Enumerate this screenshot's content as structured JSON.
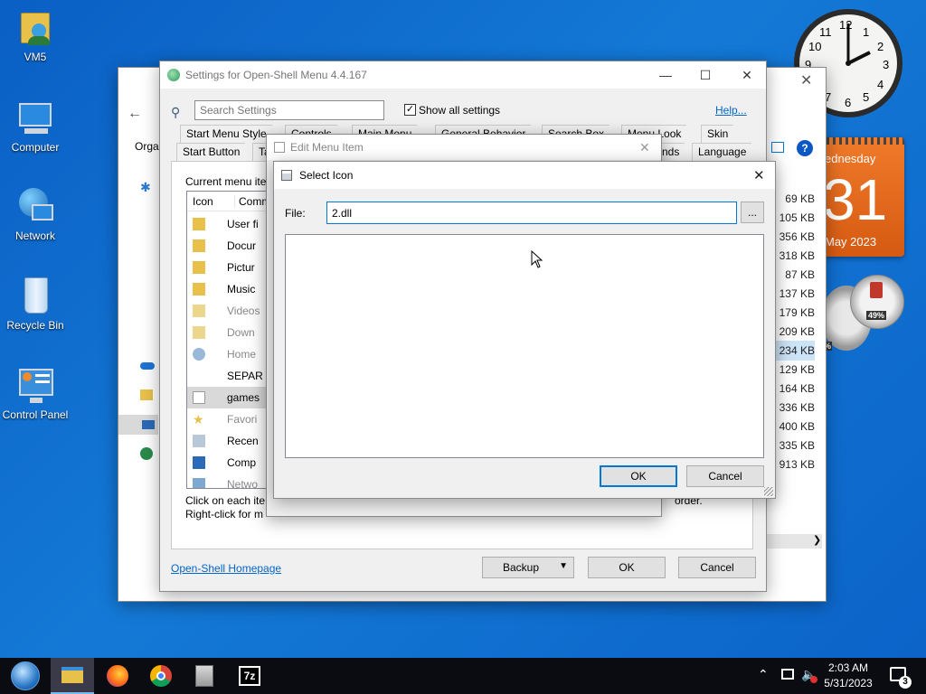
{
  "desktop": {
    "icons": [
      {
        "label": "VM5"
      },
      {
        "label": "Computer"
      },
      {
        "label": "Network"
      },
      {
        "label": "Recycle Bin"
      },
      {
        "label": "Control Panel"
      }
    ],
    "calendar": {
      "weekday": "ednesday",
      "day": "31",
      "month_year": "May 2023"
    },
    "gauge": {
      "percent": "49%",
      "percent2": "%"
    },
    "clock": {
      "numerals": [
        "12",
        "1",
        "2",
        "3",
        "4",
        "5",
        "6",
        "7",
        "8",
        "9",
        "10",
        "11"
      ]
    }
  },
  "explorer": {
    "org_label": "Orga",
    "sizes": [
      "69 KB",
      "105 KB",
      "356 KB",
      "318 KB",
      "87 KB",
      "137 KB",
      "179 KB",
      "209 KB",
      "234 KB",
      "129 KB",
      "164 KB",
      "336 KB",
      "400 KB",
      "335 KB",
      "913 KB"
    ]
  },
  "settings": {
    "title": "Settings for Open-Shell Menu 4.4.167",
    "search_placeholder": "Search Settings",
    "show_all_label": "Show all settings",
    "help_link": "Help...",
    "tabs_row1": [
      "Start Menu Style",
      "Controls",
      "Main Menu",
      "General Behavior",
      "Search Box",
      "Menu Look",
      "Skin"
    ],
    "tabs_row2": [
      "Start Button",
      "Ta",
      "nds",
      "Language"
    ],
    "current_menu_label": "Current menu ite",
    "list_header": {
      "icon": "Icon",
      "command": "Comm"
    },
    "list_items": [
      "User fi",
      "Docur",
      "Pictur",
      "Music",
      "Videos",
      "Down",
      "Home",
      "SEPAR",
      "games",
      "Favori",
      "Recen",
      "Comp",
      "Netwo"
    ],
    "hint1": "Click on each ite",
    "hint1_tail": "order.",
    "hint2": "Right-click for m",
    "homepage_link": "Open-Shell Homepage",
    "backup_label": "Backup",
    "ok_label": "OK",
    "cancel_label": "Cancel"
  },
  "edit_menu_item": {
    "title": "Edit Menu Item"
  },
  "select_icon": {
    "title": "Select Icon",
    "file_label": "File:",
    "file_value": "2.dll",
    "browse_label": "...",
    "ok_label": "OK",
    "cancel_label": "Cancel"
  },
  "taskbar": {
    "time": "2:03 AM",
    "date": "5/31/2023",
    "notification_count": "3",
    "sevenzip_label": "7z"
  }
}
